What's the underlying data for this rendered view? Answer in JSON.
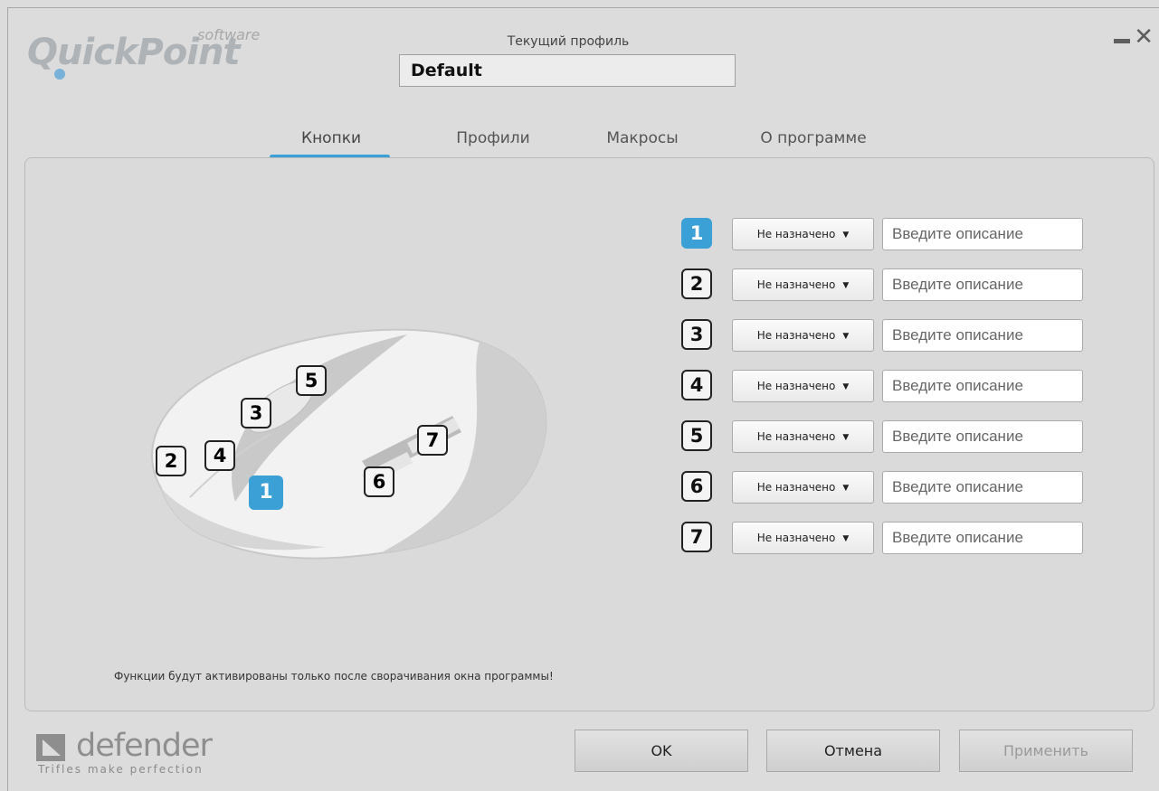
{
  "app": {
    "logo_main": "QuickPoint",
    "logo_sub": "software"
  },
  "profile": {
    "label": "Текущий профиль",
    "value": "Default"
  },
  "tabs": [
    {
      "label": "Кнопки",
      "active": true
    },
    {
      "label": "Профили",
      "active": false
    },
    {
      "label": "Макросы",
      "active": false
    },
    {
      "label": "О программе",
      "active": false
    }
  ],
  "mouse_markers": [
    "1",
    "2",
    "3",
    "4",
    "5",
    "6",
    "7"
  ],
  "buttons": [
    {
      "number": "1",
      "assignment": "Не назначено",
      "placeholder": "Введите описание",
      "selected": true
    },
    {
      "number": "2",
      "assignment": "Не назначено",
      "placeholder": "Введите описание",
      "selected": false
    },
    {
      "number": "3",
      "assignment": "Не назначено",
      "placeholder": "Введите описание",
      "selected": false
    },
    {
      "number": "4",
      "assignment": "Не назначено",
      "placeholder": "Введите описание",
      "selected": false
    },
    {
      "number": "5",
      "assignment": "Не назначено",
      "placeholder": "Введите описание",
      "selected": false
    },
    {
      "number": "6",
      "assignment": "Не назначено",
      "placeholder": "Введите описание",
      "selected": false
    },
    {
      "number": "7",
      "assignment": "Не назначено",
      "placeholder": "Введите описание",
      "selected": false
    }
  ],
  "note": "Функции будут активированы только после сворачивания окна программы!",
  "brand": {
    "name": "defender",
    "tagline": "Trifles make perfection"
  },
  "actions": {
    "ok": "OK",
    "cancel": "Отмена",
    "apply": "Применить"
  },
  "colors": {
    "accent": "#3aa0d6",
    "background": "#dcdcdc"
  }
}
